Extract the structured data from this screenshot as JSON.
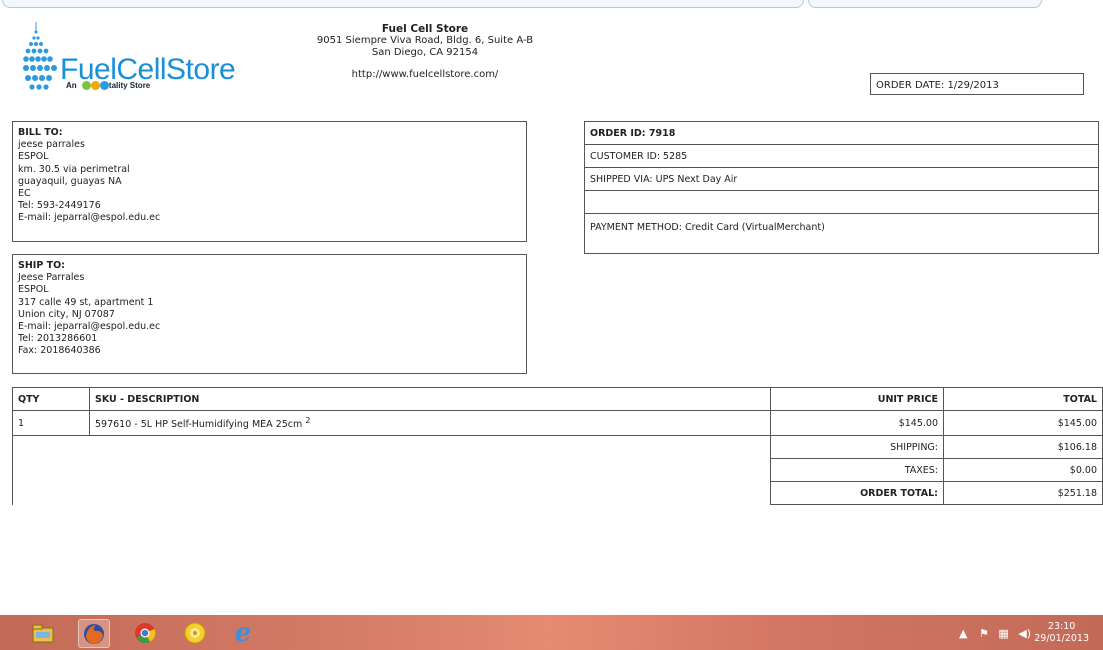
{
  "store": {
    "name": "Fuel Cell Store",
    "address1": "9051 Siempre Viva Road, Bldg. 6, Suite A-B",
    "address2": "San Diego, CA 92154",
    "url": "http://www.fuelcellstore.com/",
    "logo_text": "FuelCellStore",
    "logo_tagline_prefix": "An",
    "logo_tagline_suffix": "tality Store"
  },
  "order_date": "ORDER DATE: 1/29/2013",
  "bill_to": {
    "heading": "BILL TO:",
    "lines": [
      "jeese parrales",
      "ESPOL",
      "km. 30.5 via perimetral",
      "guayaquil, guayas NA",
      "EC",
      "Tel: 593-2449176",
      "E-mail: jeparral@espol.edu.ec"
    ]
  },
  "ship_to": {
    "heading": "SHIP TO:",
    "lines": [
      "Jeese Parrales",
      "ESPOL",
      "317 calle 49 st, apartment 1",
      "Union city, NJ 07087",
      "E-mail: jeparral@espol.edu.ec",
      "Tel: 2013286601",
      "Fax: 2018640386"
    ]
  },
  "order_info": {
    "order_id": "ORDER ID: 7918",
    "customer_id": "CUSTOMER ID: 5285",
    "shipped_via": "SHIPPED VIA: UPS Next Day Air",
    "blank": "",
    "payment_method": "PAYMENT METHOD: Credit Card (VirtualMerchant)"
  },
  "items_table": {
    "headers": {
      "qty": "QTY",
      "sku": "SKU - DESCRIPTION",
      "unit_price": "UNIT PRICE",
      "total": "TOTAL"
    },
    "rows": [
      {
        "qty": "1",
        "description": "597610 - 5L HP Self-Humidifying MEA 25cm",
        "sup": "2",
        "unit_price": "$145.00",
        "total": "$145.00"
      }
    ],
    "summary": {
      "shipping_label": "SHIPPING:",
      "shipping": "$106.18",
      "taxes_label": "TAXES:",
      "taxes": "$0.00",
      "order_total_label": "ORDER TOTAL:",
      "order_total": "$251.18"
    }
  },
  "taskbar": {
    "apps": [
      "file-explorer-icon",
      "firefox-icon",
      "chrome-icon",
      "app-icon",
      "internet-explorer-icon"
    ],
    "time": "23:10",
    "date": "29/01/2013"
  },
  "colors": {
    "logo_blue": "#1a8fd6",
    "taskbar": "#d47b66"
  }
}
